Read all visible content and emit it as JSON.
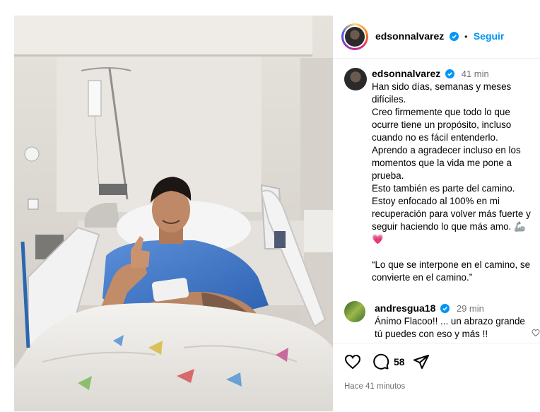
{
  "post": {
    "username": "edsonnalvarez",
    "follow_label": "Seguir",
    "caption_time": "41 min",
    "caption_text": "Han sido días, semanas y meses difíciles.\nCreo firmemente que todo lo que ocurre tiene un propósito, incluso cuando no es fácil entenderlo.\nAprendo a agradecer incluso en los momentos que la vida me pone a prueba.\nEsto también es parte del camino.\nEstoy enfocado al 100% en mi recuperación para volver más fuerte y seguir haciendo lo que más amo. 🦾\n💗\n\n“Lo que se interpone en el camino, se convierte en el camino.”",
    "comment": {
      "username": "andresgua18",
      "time": "29 min",
      "text": "Ánimo Flacoo!! ... un abrazo grande tú puedes con eso y más !!"
    },
    "comments_count": "58",
    "posted_ago": "Hace 41 minutos"
  },
  "icons": [
    "verified-badge-icon",
    "like-heart-icon",
    "comment-icon",
    "share-icon",
    "comment-like-icon"
  ],
  "colors": {
    "accent": "#0095f6",
    "muted": "#737373",
    "border": "#efefef"
  }
}
